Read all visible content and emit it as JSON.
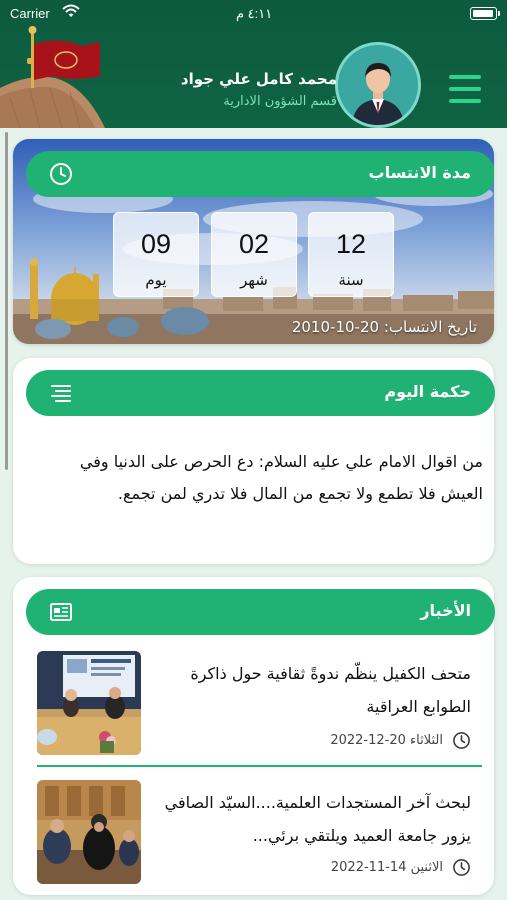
{
  "status_bar": {
    "carrier": "Carrier",
    "time": "٤:١١ م"
  },
  "header": {
    "user_name": "محمد كامل علي جواد",
    "department": "قسم الشؤون الادارية",
    "menu_icon": "hamburger-icon"
  },
  "tenure": {
    "title": "مدة الانتساب",
    "icon": "clock-icon",
    "years_value": "12",
    "years_label": "سنة",
    "months_value": "02",
    "months_label": "شهر",
    "days_value": "09",
    "days_label": "يوم",
    "join_date": "تاريخ الانتساب: 20-10-2010"
  },
  "wisdom": {
    "title": "حكمة اليوم",
    "icon": "text-lines-icon",
    "text": "من اقوال الامام علي عليه السلام: دع الحرص على الدنيا وفي العيش فلا تطمع ولا تجمع من المال فلا تدري لمن تجمع."
  },
  "news": {
    "title": "الأخبار",
    "icon": "newspaper-icon",
    "items": [
      {
        "title": "متحف الكفيل ينظّم ندوةً ثقافية حول ذاكرة الطوابع العراقية",
        "date": "الثلاثاء 20-12-2022"
      },
      {
        "title": "لبحث آخر المستجدات العلمية....السيّد الصافي يزور جامعة العميد ويلتقي برئي...",
        "date": "الاثنين 14-11-2022"
      }
    ]
  },
  "colors": {
    "header": "#0d5a3e",
    "accent": "#1fb273",
    "background": "#e6f3ec"
  }
}
